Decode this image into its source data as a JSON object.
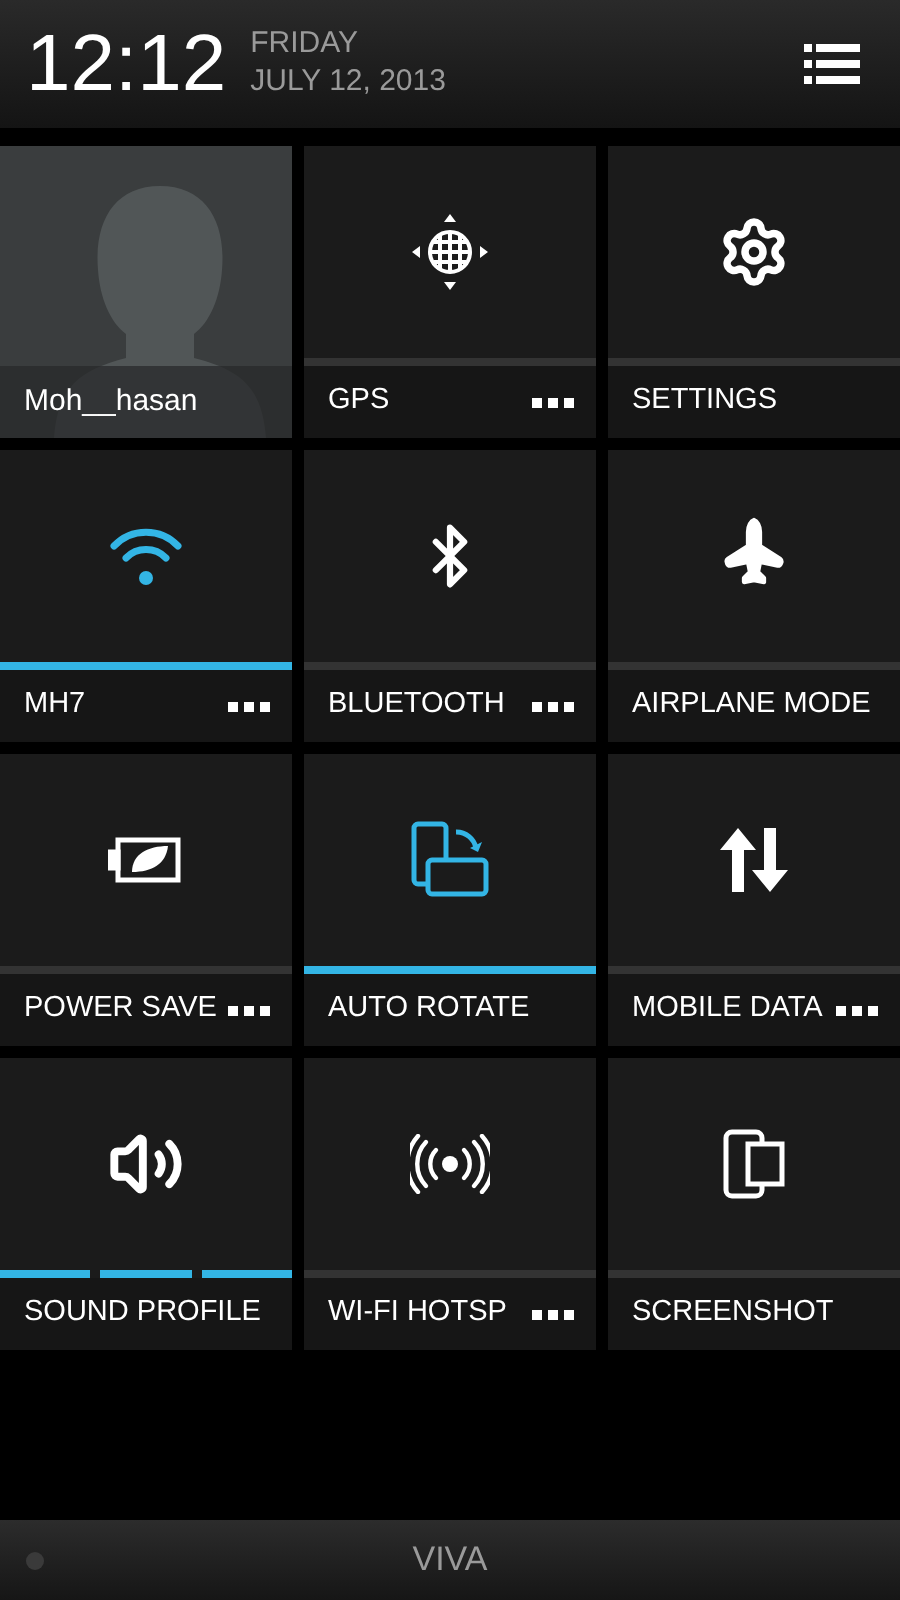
{
  "header": {
    "time": "12:12",
    "day": "FRIDAY",
    "date": "JULY 12, 2013"
  },
  "tiles": [
    {
      "kind": "user",
      "label": "Moh__hasan"
    },
    {
      "kind": "toggle",
      "label": "GPS",
      "on": false,
      "more": true
    },
    {
      "kind": "toggle",
      "label": "SETTINGS",
      "on": false,
      "more": false
    },
    {
      "kind": "toggle",
      "label": "MH7",
      "on": true,
      "more": true
    },
    {
      "kind": "toggle",
      "label": "BLUETOOTH",
      "on": false,
      "more": true
    },
    {
      "kind": "toggle",
      "label": "AIRPLANE MODE",
      "on": false,
      "more": false
    },
    {
      "kind": "toggle",
      "label": "POWER SAVE",
      "on": false,
      "more": true
    },
    {
      "kind": "toggle",
      "label": "AUTO ROTATE",
      "on": true,
      "more": false
    },
    {
      "kind": "toggle",
      "label": "MOBILE DATA",
      "on": false,
      "more": true
    },
    {
      "kind": "segmented",
      "label": "SOUND PROFILE",
      "on": true,
      "more": false
    },
    {
      "kind": "toggle",
      "label": "WI-FI HOTSP",
      "on": false,
      "more": true
    },
    {
      "kind": "toggle",
      "label": "SCREENSHOT",
      "on": false,
      "more": false
    }
  ],
  "footer": {
    "carrier": "VIVA"
  }
}
